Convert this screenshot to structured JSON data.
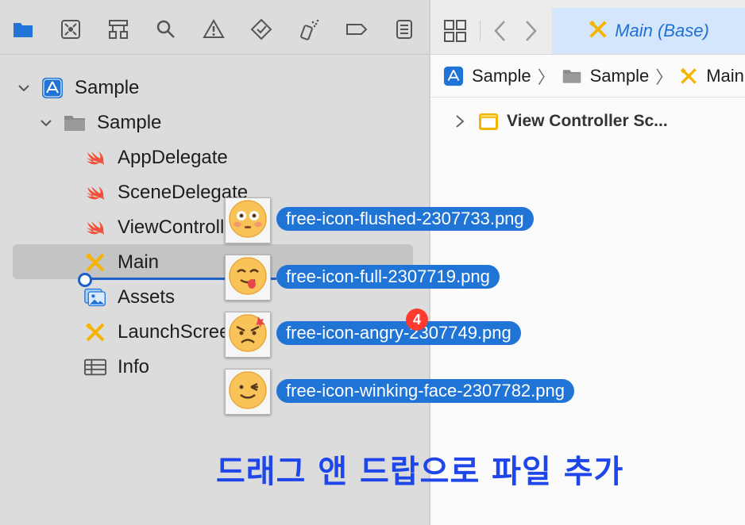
{
  "navigator": {
    "toolbar_icons": [
      "folder-icon",
      "source-control-icon",
      "hierarchy-icon",
      "search-icon",
      "warning-icon",
      "test-icon",
      "debug-icon",
      "breakpoint-icon",
      "report-icon"
    ],
    "tree": [
      {
        "label": "Sample",
        "icon": "app-project-icon",
        "expanded": true
      },
      {
        "label": "Sample",
        "icon": "folder-icon",
        "expanded": true
      },
      {
        "label": "AppDelegate",
        "icon": "swift-icon"
      },
      {
        "label": "SceneDelegate",
        "icon": "swift-icon"
      },
      {
        "label": "ViewController",
        "icon": "swift-icon"
      },
      {
        "label": "Main",
        "icon": "storyboard-icon",
        "selected": true
      },
      {
        "label": "Assets",
        "icon": "assets-icon"
      },
      {
        "label": "LaunchScreen",
        "icon": "storyboard-icon"
      },
      {
        "label": "Info",
        "icon": "plist-icon"
      }
    ]
  },
  "editor": {
    "active_tab": "Main (Base)",
    "breadcrumb": [
      "Sample",
      "Sample",
      "Main"
    ],
    "outline_item": "View Controller Sc..."
  },
  "drag": {
    "files": [
      {
        "name": "free-icon-flushed-2307733.png",
        "icon": "flushed-face-icon"
      },
      {
        "name": "free-icon-full-2307719.png",
        "icon": "tongue-face-icon"
      },
      {
        "name": "free-icon-angry-2307749.png",
        "icon": "angry-face-icon"
      },
      {
        "name": "free-icon-winking-face-2307782.png",
        "icon": "winking-face-icon"
      }
    ],
    "count_badge": "4"
  },
  "caption": "드래그 앤 드랍으로 파일 추가",
  "colors": {
    "accent": "#1f74d6",
    "selection": "#c4c4c4",
    "badge": "#ff3b30",
    "caption": "#1e46e8"
  }
}
